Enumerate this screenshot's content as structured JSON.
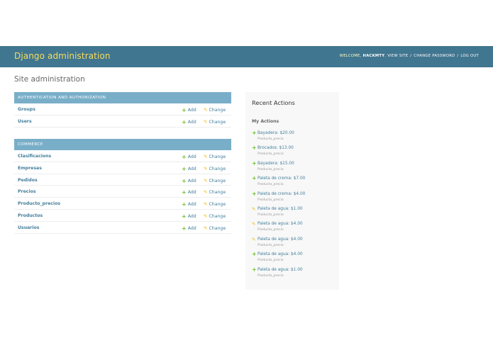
{
  "header": {
    "branding": "Django administration",
    "welcome_text": "Welcome,",
    "username": "HACKMTY",
    "view_site": "View site",
    "separator": "/",
    "change_password": "Change password",
    "log_out": "Log out"
  },
  "page_title": "Site administration",
  "apps": [
    {
      "caption": "Authentication and Authorization",
      "models": [
        {
          "name": "Groups",
          "add": "Add",
          "change": "Change"
        },
        {
          "name": "Users",
          "add": "Add",
          "change": "Change"
        }
      ]
    },
    {
      "caption": "Commerce",
      "models": [
        {
          "name": "Clasificacions",
          "add": "Add",
          "change": "Change"
        },
        {
          "name": "Empresas",
          "add": "Add",
          "change": "Change"
        },
        {
          "name": "Pedidos",
          "add": "Add",
          "change": "Change"
        },
        {
          "name": "Precios",
          "add": "Add",
          "change": "Change"
        },
        {
          "name": "Producto_precios",
          "add": "Add",
          "change": "Change"
        },
        {
          "name": "Productos",
          "add": "Add",
          "change": "Change"
        },
        {
          "name": "Usuarios",
          "add": "Add",
          "change": "Change"
        }
      ]
    }
  ],
  "recent_actions": {
    "title": "Recent Actions",
    "subtitle": "My Actions",
    "items": [
      {
        "label": "Bayadera: $20.00",
        "type": "Producto_precio",
        "kind": "added"
      },
      {
        "label": "Brocados: $13.00",
        "type": "Producto_precio",
        "kind": "added"
      },
      {
        "label": "Bayadera: $15.00",
        "type": "Producto_precio",
        "kind": "added"
      },
      {
        "label": "Paleta de crema: $7.00",
        "type": "Producto_precio",
        "kind": "added"
      },
      {
        "label": "Paleta de crema: $4.00",
        "type": "Producto_precio",
        "kind": "added"
      },
      {
        "label": "Paleta de agua: $1.00",
        "type": "Producto_precio",
        "kind": "changed"
      },
      {
        "label": "Paleta de agua: $4.00",
        "type": "Producto_precio",
        "kind": "changed"
      },
      {
        "label": "Paleta de agua: $4.00",
        "type": "Producto_precio",
        "kind": "changed"
      },
      {
        "label": "Paleta de agua: $4.00",
        "type": "Producto_precio",
        "kind": "added"
      },
      {
        "label": "Paleta de agua: $1.00",
        "type": "Producto_precio",
        "kind": "added"
      }
    ]
  },
  "icons": {
    "add": "plus-icon",
    "change": "pencil-icon"
  },
  "colors": {
    "header_bg": "#417690",
    "branding": "#f5dd5d",
    "caption_bg": "#79aec8",
    "link": "#447e9b",
    "add_icon": "#70bf2b",
    "change_icon": "#efb80b"
  }
}
